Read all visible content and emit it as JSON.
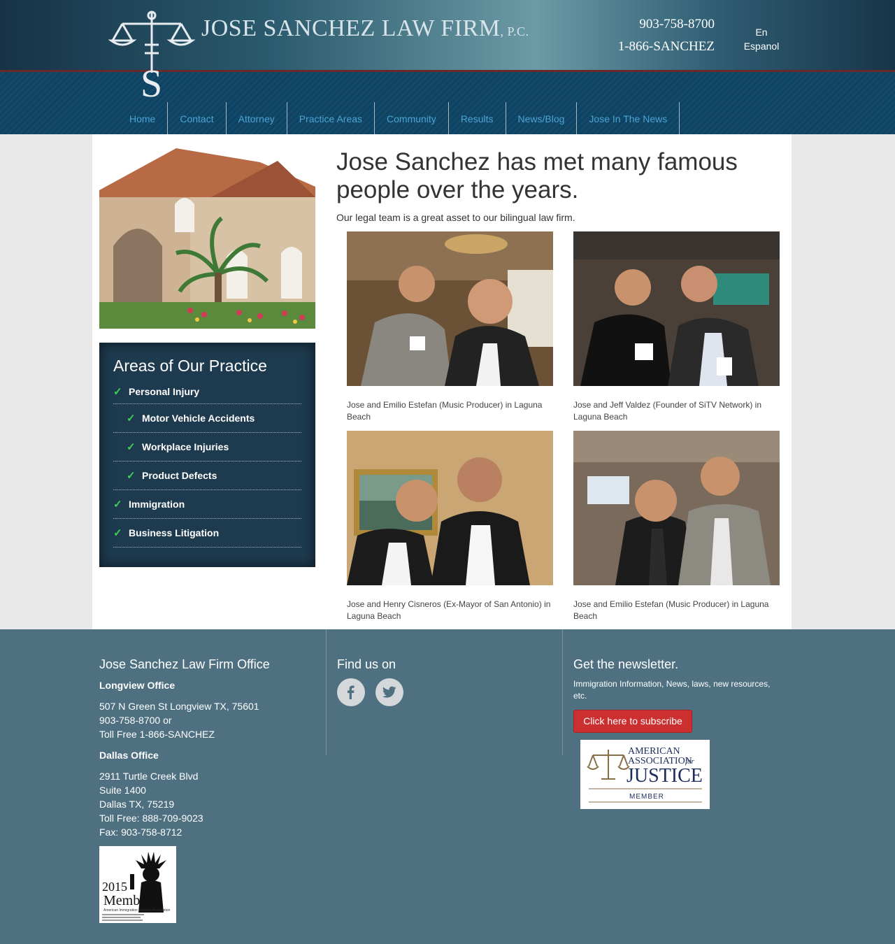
{
  "header": {
    "brand_main": "JOSE SANCHEZ LAW FIRM",
    "brand_suffix": ", P.C.",
    "phone_primary": "903-758-8700",
    "phone_toll_free": "1-866-SANCHEZ",
    "lang_en": "En",
    "lang_es": "Espanol"
  },
  "nav": {
    "items": [
      "Home",
      "Contact",
      "Attorney",
      "Practice Areas",
      "Community",
      "Results",
      "News/Blog",
      "Jose In The News"
    ]
  },
  "sidebar": {
    "title": "Areas of Our Practice",
    "items": [
      {
        "label": "Personal Injury",
        "sub": false
      },
      {
        "label": "Motor Vehicle Accidents",
        "sub": true
      },
      {
        "label": "Workplace Injuries",
        "sub": true
      },
      {
        "label": "Product Defects",
        "sub": true
      },
      {
        "label": "Immigration",
        "sub": false
      },
      {
        "label": "Business Litigation",
        "sub": false
      }
    ]
  },
  "main": {
    "heading": "Jose Sanchez has met many famous people over the years.",
    "subtitle": "Our legal team is a great asset to our bilingual law firm.",
    "photos": [
      {
        "caption": "Jose and Emilio Estefan (Music Producer) in Laguna Beach"
      },
      {
        "caption": "Jose and Jeff Valdez (Founder of SiTV Network) in Laguna Beach"
      },
      {
        "caption": "Jose and Henry Cisneros (Ex-Mayor of San Antonio) in Laguna Beach"
      },
      {
        "caption": "Jose and Emilio Estefan (Music Producer) in Laguna Beach"
      }
    ]
  },
  "footer": {
    "office_title": "Jose Sanchez Law Firm Office",
    "longview_label": "Longview Office",
    "longview_lines": [
      "507 N Green St Longview TX, 75601",
      "903-758-8700 or",
      "Toll Free 1-866-SANCHEZ"
    ],
    "dallas_label": "Dallas Office",
    "dallas_lines": [
      "2911 Turtle Creek Blvd",
      "Suite 1400",
      "Dallas TX, 75219",
      "Toll Free: 888-709-9023",
      "Fax: 903-758-8712"
    ],
    "find_title": "Find us on",
    "social_icons": [
      "facebook-icon",
      "twitter-icon"
    ],
    "newsletter_title": "Get the newsletter.",
    "newsletter_text": "Immigration Information, News, laws, new resources, etc.",
    "subscribe_label": "Click here to subscribe",
    "aaj_badge": {
      "line1": "AMERICAN",
      "line2": "ASSOCIATION",
      "line2b": "for",
      "line3": "JUSTICE",
      "line4": "MEMBER"
    },
    "aila_badge": {
      "year": "2015",
      "label": "Member",
      "org": "American Immigration Lawyers Association"
    }
  },
  "colors": {
    "header_dark": "#173247",
    "nav_band": "#0f4160",
    "nav_link": "#4aa4d4",
    "sidebar_bg": "#1e3a4f",
    "check": "#3fcf5a",
    "footer_bg": "#4f7080",
    "subscribe_btn": "#cc2f2f"
  }
}
